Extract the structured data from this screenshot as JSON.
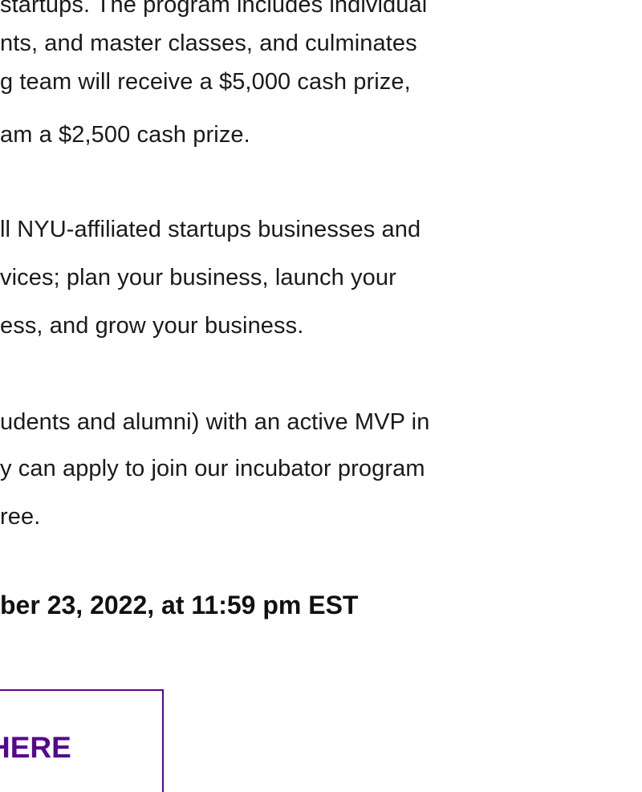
{
  "article": {
    "paragraph_1": [
      "startups. The program includes individual",
      "nts, and master classes, and culminates",
      "g team will receive a $5,000 cash prize,",
      "am a $2,500 cash prize."
    ],
    "paragraph_2": [
      "ll NYU-affiliated startups businesses and",
      "vices; plan your business, launch your",
      "ess, and grow your business."
    ],
    "paragraph_3": [
      "udents and alumni) with an active MVP in",
      "y can apply to join our incubator program",
      "ree."
    ],
    "deadline": "ber 23, 2022, at 11:59 pm EST"
  },
  "cta": {
    "label": "HERE"
  },
  "colors": {
    "accent": "#57068c",
    "text": "#1a1a1a"
  }
}
